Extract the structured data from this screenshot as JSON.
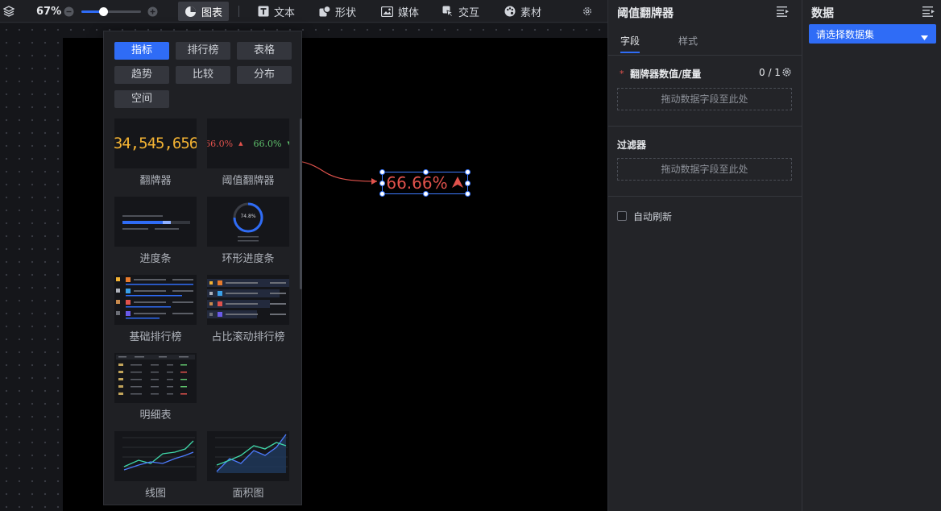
{
  "toolbar": {
    "zoom": "67%",
    "zoom_level": 0.36,
    "tabs": [
      {
        "label": "图表",
        "icon": "chart-icon",
        "active": true
      },
      {
        "label": "文本",
        "icon": "text-icon"
      },
      {
        "label": "形状",
        "icon": "shape-icon"
      },
      {
        "label": "媒体",
        "icon": "media-icon"
      },
      {
        "label": "交互",
        "icon": "interaction-icon"
      },
      {
        "label": "素材",
        "icon": "asset-icon"
      }
    ]
  },
  "flyout": {
    "categories": [
      "指标",
      "排行榜",
      "表格",
      "趋势",
      "比较",
      "分布",
      "空间"
    ],
    "items": [
      {
        "label": "翻牌器"
      },
      {
        "label": "阈值翻牌器"
      },
      {
        "label": "进度条"
      },
      {
        "label": "环形进度条"
      },
      {
        "label": "基础排行榜"
      },
      {
        "label": "占比滚动排行榜"
      },
      {
        "label": "明细表"
      },
      {
        "label": "线图"
      },
      {
        "label": "面积图"
      }
    ],
    "flip_value": "34,545,656",
    "threshold_up": "66.0%",
    "threshold_down": "66.0%",
    "ring_value": "74.8%"
  },
  "canvas": {
    "widget_value": "66.66%"
  },
  "props": {
    "title": "阈值翻牌器",
    "tabs": [
      "字段",
      "样式"
    ],
    "field_label": "翻牌器数值/度量",
    "field_count": "0 / 1",
    "drop_hint": "拖动数据字段至此处",
    "filter_label": "过滤器",
    "filter_drop_hint": "拖动数据字段至此处",
    "auto_refresh": "自动刷新"
  },
  "data_panel": {
    "title": "数据",
    "select_placeholder": "请选择数据集"
  },
  "colors": {
    "accent": "#2f6cf6",
    "danger": "#e0524c",
    "success": "#5fc26c",
    "gold": "#f2b233"
  }
}
